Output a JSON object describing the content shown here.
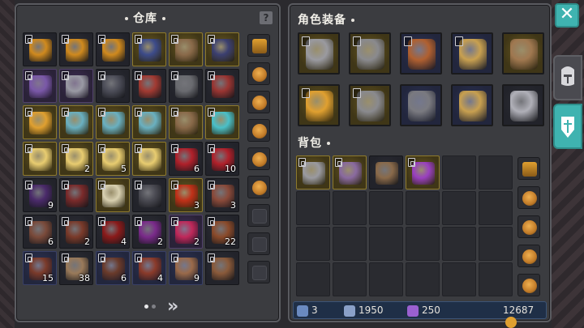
{
  "warehouse": {
    "title": "仓库",
    "help_label": "?",
    "next_label": "»",
    "pages": {
      "count": 2,
      "current": 1
    },
    "rows": [
      [
        {
          "rarity": "dark",
          "color": "#d08a1e",
          "qty": "",
          "tag": true,
          "icon": "bronze-helm-icon"
        },
        {
          "rarity": "dark",
          "color": "#d08a1e",
          "qty": "",
          "tag": true,
          "icon": "bronze-helm-icon"
        },
        {
          "rarity": "dark",
          "color": "#d08a1e",
          "qty": "",
          "tag": true,
          "icon": "bronze-helm-icon"
        },
        {
          "rarity": "gold",
          "color": "#3c4b8a",
          "qty": "",
          "tag": true,
          "icon": "crossbow-icon"
        },
        {
          "rarity": "gold",
          "color": "#8a6a4a",
          "qty": "",
          "tag": true,
          "icon": "pickaxe-icon"
        },
        {
          "rarity": "gold",
          "color": "#3b3f70",
          "qty": "",
          "tag": true,
          "icon": "dagger-icon"
        }
      ],
      [
        {
          "rarity": "purple",
          "color": "#7a58a8",
          "qty": "",
          "tag": true,
          "icon": "skull-helm-icon"
        },
        {
          "rarity": "purple",
          "color": "#9a9aa4",
          "qty": "",
          "tag": true,
          "icon": "steel-helm-icon"
        },
        {
          "rarity": "dark",
          "color": "#4c4d58",
          "qty": "",
          "tag": true,
          "icon": "dark-armor-icon"
        },
        {
          "rarity": "dark",
          "color": "#a23a32",
          "qty": "",
          "tag": true,
          "icon": "red-armor-icon"
        },
        {
          "rarity": "dark",
          "color": "#6a6b70",
          "qty": "",
          "tag": true,
          "icon": "plate-armor-icon"
        },
        {
          "rarity": "dark",
          "color": "#9a3532",
          "qty": "",
          "tag": true,
          "icon": "red-armor-icon"
        }
      ],
      [
        {
          "rarity": "gold",
          "color": "#e0a030",
          "qty": "",
          "tag": true,
          "icon": "amulet-icon"
        },
        {
          "rarity": "gold",
          "color": "#6ab0c0",
          "qty": "",
          "tag": true,
          "icon": "crystal-ring-icon"
        },
        {
          "rarity": "gold",
          "color": "#6ab0c0",
          "qty": "",
          "tag": true,
          "icon": "crystal-ring-icon"
        },
        {
          "rarity": "gold",
          "color": "#6ab0c0",
          "qty": "",
          "tag": true,
          "icon": "crystal-ring-icon"
        },
        {
          "rarity": "gold",
          "color": "#8a6a4a",
          "qty": "",
          "tag": true,
          "icon": "spear-icon"
        },
        {
          "rarity": "gold",
          "color": "#4ac0c8",
          "qty": "",
          "tag": true,
          "icon": "ice-crystal-icon"
        }
      ],
      [
        {
          "rarity": "gold",
          "color": "#e8cc70",
          "qty": "",
          "tag": true,
          "icon": "scroll-icon"
        },
        {
          "rarity": "gold",
          "color": "#e8cc70",
          "qty": "2",
          "tag": true,
          "icon": "scroll-icon"
        },
        {
          "rarity": "gold",
          "color": "#e8cc70",
          "qty": "5",
          "tag": true,
          "icon": "scroll-icon"
        },
        {
          "rarity": "gold",
          "color": "#e8cc70",
          "qty": "",
          "tag": true,
          "icon": "scroll-icon"
        },
        {
          "rarity": "dark",
          "color": "#b0202a",
          "qty": "6",
          "tag": true,
          "icon": "red-flower-icon"
        },
        {
          "rarity": "dark",
          "color": "#b0202a",
          "qty": "10",
          "tag": true,
          "icon": "red-flower-icon"
        }
      ],
      [
        {
          "rarity": "dark",
          "color": "#4a2a6a",
          "qty": "9",
          "tag": true,
          "icon": "purple-gem-icon"
        },
        {
          "rarity": "dark",
          "color": "#7a2a2a",
          "qty": "",
          "tag": true,
          "icon": "claw-icon"
        },
        {
          "rarity": "gold",
          "color": "#d8d0b0",
          "qty": "",
          "tag": true,
          "icon": "orb-icon"
        },
        {
          "rarity": "dark",
          "color": "#4a4a52",
          "qty": "",
          "tag": true,
          "icon": "dark-stone-icon"
        },
        {
          "rarity": "gold",
          "color": "#c03018",
          "qty": "3",
          "tag": true,
          "icon": "spiral-icon"
        },
        {
          "rarity": "dark",
          "color": "#8a4a3a",
          "qty": "3",
          "tag": true,
          "icon": "claw-icon"
        }
      ],
      [
        {
          "rarity": "dark",
          "color": "#7a4a3a",
          "qty": "6",
          "tag": true,
          "icon": "bone-icon"
        },
        {
          "rarity": "dark",
          "color": "#7a3a2a",
          "qty": "2",
          "tag": true,
          "icon": "tooth-icon"
        },
        {
          "rarity": "dark",
          "color": "#8a1a1a",
          "qty": "4",
          "tag": true,
          "icon": "blood-flower-icon"
        },
        {
          "rarity": "dark",
          "color": "#7a2a8a",
          "qty": "2",
          "tag": true,
          "icon": "purple-rose-icon"
        },
        {
          "rarity": "purple",
          "color": "#c0285a",
          "qty": "2",
          "tag": true,
          "icon": "pink-flower-icon"
        },
        {
          "rarity": "dark",
          "color": "#8a4a2a",
          "qty": "22",
          "tag": true,
          "icon": "leather-icon"
        }
      ],
      [
        {
          "rarity": "blue",
          "color": "#7a3a2a",
          "qty": "15",
          "tag": true,
          "icon": "claw-icon"
        },
        {
          "rarity": "dark",
          "color": "#9a7a5a",
          "qty": "38",
          "tag": true,
          "icon": "fang-icon"
        },
        {
          "rarity": "blue",
          "color": "#6a3a2a",
          "qty": "6",
          "tag": true,
          "icon": "claw-icon"
        },
        {
          "rarity": "blue",
          "color": "#8a3a2a",
          "qty": "4",
          "tag": true,
          "icon": "hide-icon"
        },
        {
          "rarity": "blue",
          "color": "#9a6a4a",
          "qty": "9",
          "tag": true,
          "icon": "pelt-icon"
        },
        {
          "rarity": "dark",
          "color": "#8a5a3a",
          "qty": "",
          "tag": true,
          "icon": "talon-icon"
        }
      ]
    ],
    "side_items": [
      {
        "color": "#d08a1e",
        "icon": "treasure-chest-icon",
        "kind": "chest"
      },
      {
        "color": "#c07a28",
        "icon": "pouch-icon",
        "kind": "pouch"
      },
      {
        "color": "#c07a28",
        "icon": "pouch-icon",
        "kind": "pouch"
      },
      {
        "color": "#c07a28",
        "icon": "pouch-icon",
        "kind": "pouch"
      },
      {
        "color": "#c07a28",
        "icon": "pouch-icon",
        "kind": "pouch"
      },
      {
        "color": "#c07a28",
        "icon": "pouch-icon",
        "kind": "pouch"
      },
      {
        "color": "#2d2e33",
        "icon": "locked-slot-icon",
        "kind": "empty"
      },
      {
        "color": "#2d2e33",
        "icon": "locked-slot-icon",
        "kind": "empty"
      },
      {
        "color": "#2d2e33",
        "icon": "locked-slot-icon",
        "kind": "empty"
      }
    ]
  },
  "equipment": {
    "title": "角色装备",
    "slots": [
      {
        "rarity": "gold",
        "color": "#9a9aa0",
        "icon": "great-helm-icon",
        "tag": true
      },
      {
        "rarity": "gold",
        "color": "#8a8a8e",
        "icon": "chest-armor-icon",
        "tag": true
      },
      {
        "rarity": "blue",
        "color": "#b06030",
        "icon": "leather-armor-icon",
        "tag": true
      },
      {
        "rarity": "blue",
        "color": "#c8a050",
        "icon": "gold-ring-icon",
        "tag": true
      },
      {
        "rarity": "gold",
        "color": "#a07850",
        "icon": "battle-axe-icon",
        "tag": false
      },
      {
        "rarity": "gold",
        "color": "#e0a030",
        "icon": "amulet-icon",
        "tag": true
      },
      {
        "rarity": "gold",
        "color": "#8a8a8e",
        "icon": "gauntlet-icon",
        "tag": true
      },
      {
        "rarity": "blue",
        "color": "#7a7a80",
        "icon": "boots-icon",
        "tag": false
      },
      {
        "rarity": "blue",
        "color": "#c8a050",
        "icon": "gold-ring-icon",
        "tag": false
      },
      {
        "rarity": "dark",
        "color": "#b0b0b8",
        "icon": "sword-silhouette-icon",
        "tag": false
      }
    ]
  },
  "backpack": {
    "title": "背包",
    "items": [
      {
        "rarity": "gold",
        "color": "#9a9aa0",
        "icon": "great-helm-icon",
        "tag": true
      },
      {
        "rarity": "gold",
        "color": "#8a6aa0",
        "icon": "battle-axe-icon",
        "tag": true
      },
      {
        "rarity": "dark",
        "color": "#8a6a4a",
        "icon": "hooded-helm-icon",
        "tag": false
      },
      {
        "rarity": "gold",
        "color": "#9a40c0",
        "icon": "magic-staff-icon",
        "tag": true
      }
    ],
    "side_items": [
      {
        "color": "#d08a1e",
        "icon": "treasure-chest-icon"
      },
      {
        "color": "#c07a28",
        "icon": "potion-pouch-icon"
      },
      {
        "color": "#c07a28",
        "icon": "potion-pouch-icon"
      },
      {
        "color": "#c07a28",
        "icon": "pouch-icon"
      },
      {
        "color": "#c07a28",
        "icon": "pouch-icon"
      }
    ]
  },
  "status": {
    "attack": "3",
    "defense": "1950",
    "gems": "250",
    "gold": "12687",
    "attack_color": "#6a8ac0",
    "defense_color": "#8aa0c8",
    "gem_color": "#9a60d0",
    "gold_color": "#e0a030"
  },
  "tabs": {
    "close_label": "✕",
    "accent": "#3fb3b0"
  }
}
